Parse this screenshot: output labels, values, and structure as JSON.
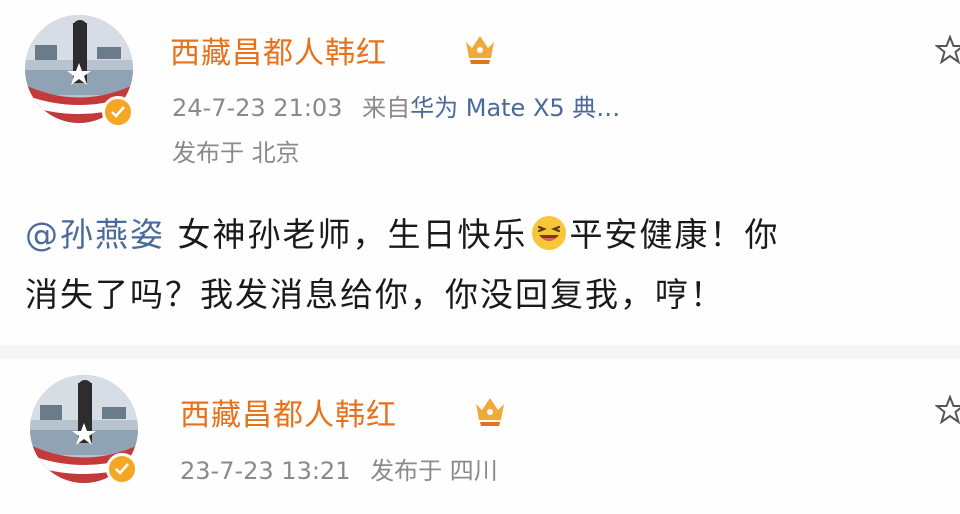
{
  "posts": [
    {
      "username": "西藏昌都人韩红",
      "timestamp": "24-7-23 21:03",
      "source_prefix": "来自",
      "source": "华为 Mate X5 典…",
      "location": "发布于 北京",
      "mention": "@孙燕姿",
      "text_part1": " 女神孙老师，生日快乐",
      "emoji": "laughing-face",
      "text_part2": "平安健康！你",
      "text_line2": "消失了吗？我发消息给你，你没回复我，哼！",
      "icons": [
        "avatar",
        "verified-badge-icon",
        "vip-crown-icon",
        "star-icon"
      ]
    },
    {
      "username": "西藏昌都人韩红",
      "timestamp": "23-7-23 13:21",
      "location": "发布于 四川",
      "icons": [
        "avatar",
        "verified-badge-icon",
        "vip-crown-icon",
        "star-icon"
      ]
    }
  ],
  "colors": {
    "username": "#e8711a",
    "meta": "#8a8a8a",
    "link": "#4a6b9a",
    "text": "#1a1a1a",
    "badge": "#f5a623"
  }
}
